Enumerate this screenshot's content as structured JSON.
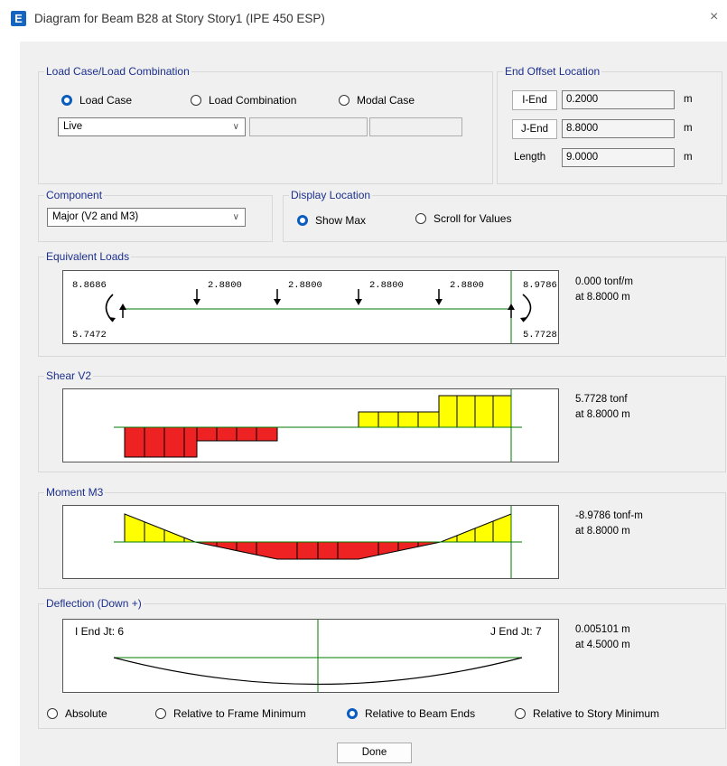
{
  "window": {
    "title": "Diagram for Beam B28 at Story Story1 (IPE 450 ESP)",
    "icon_letter": "E",
    "close_glyph": "×"
  },
  "load_case_group": {
    "legend": "Load Case/Load Combination",
    "options": [
      {
        "label": "Load Case",
        "selected": true
      },
      {
        "label": "Load Combination",
        "selected": false
      },
      {
        "label": "Modal Case",
        "selected": false
      }
    ],
    "combo_value": "Live"
  },
  "end_offset": {
    "legend": "End Offset Location",
    "i_end_label": "I-End",
    "i_end_value": "0.2000",
    "j_end_label": "J-End",
    "j_end_value": "8.8000",
    "length_label": "Length",
    "length_value": "9.0000",
    "unit": "m"
  },
  "component": {
    "legend": "Component",
    "value": "Major (V2 and M3)"
  },
  "display_location": {
    "legend": "Display Location",
    "options": [
      {
        "label": "Show Max",
        "selected": true
      },
      {
        "label": "Scroll for Values",
        "selected": false
      }
    ]
  },
  "equivalent_loads": {
    "legend": "Equivalent Loads",
    "left_moment": "8.8686",
    "left_reaction": "5.7472",
    "right_moment": "8.9786",
    "right_reaction": "5.7728",
    "point_loads": [
      "2.8800",
      "2.8800",
      "2.8800",
      "2.8800"
    ],
    "value_line1": "0.000 tonf/m",
    "value_line2": "at 8.8000 m"
  },
  "shear": {
    "legend": "Shear V2",
    "value_line1": "5.7728 tonf",
    "value_line2": "at 8.8000 m"
  },
  "moment": {
    "legend": "Moment M3",
    "value_line1": "-8.9786 tonf-m",
    "value_line2": "at 8.8000 m"
  },
  "deflection": {
    "legend": "Deflection (Down +)",
    "i_end_label": "I End Jt: 6",
    "j_end_label": "J End Jt: 7",
    "value_line1": "0.005101 m",
    "value_line2": "at 4.5000 m",
    "options": [
      {
        "label": "Absolute",
        "selected": false
      },
      {
        "label": "Relative to Frame Minimum",
        "selected": false
      },
      {
        "label": "Relative to Beam Ends",
        "selected": true
      },
      {
        "label": "Relative to Story Minimum",
        "selected": false
      }
    ]
  },
  "done_label": "Done",
  "colors": {
    "positive_fill": "#ffff00",
    "negative_fill": "#ee2222",
    "axis": "#007a00",
    "accent": "#0b5cbf"
  }
}
